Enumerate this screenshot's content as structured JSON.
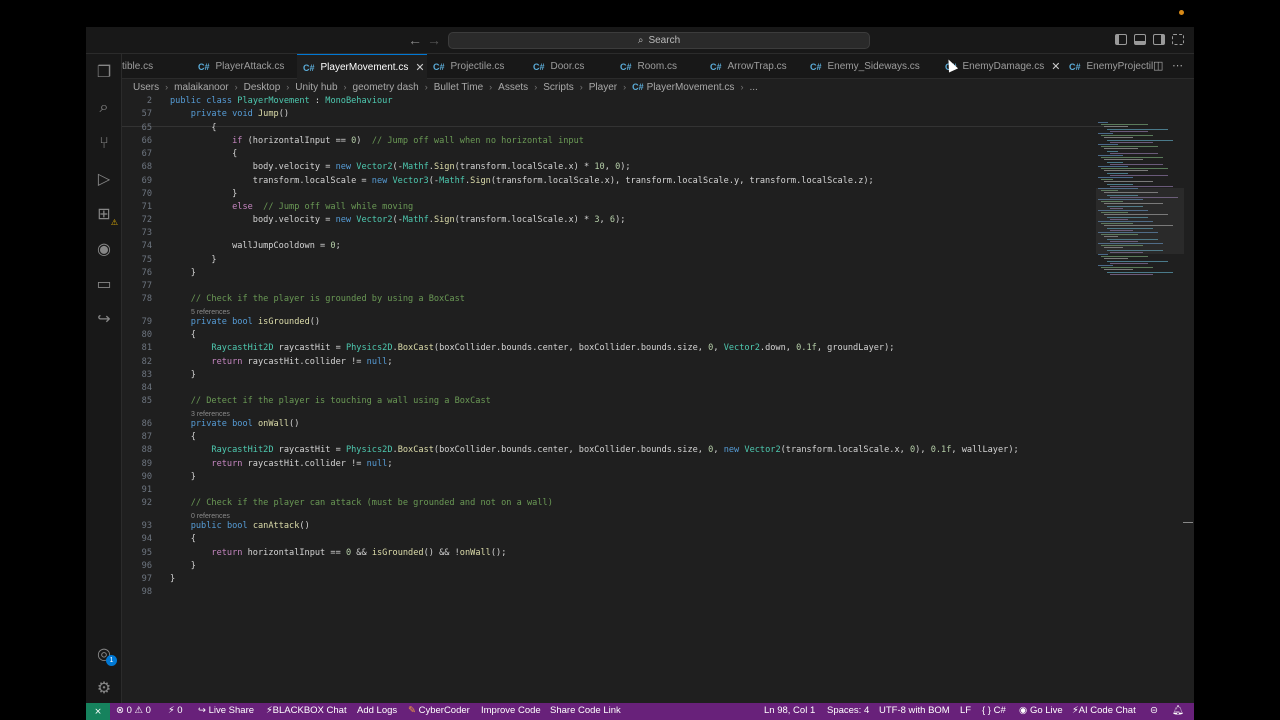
{
  "titlebar": {
    "search_placeholder": "Search",
    "search_icon": "search-icon"
  },
  "tabs": [
    {
      "label": "tible.cs",
      "active": false
    },
    {
      "label": "PlayerAttack.cs",
      "active": false
    },
    {
      "label": "PlayerMovement.cs",
      "active": true
    },
    {
      "label": "Projectile.cs",
      "active": false
    },
    {
      "label": "Door.cs",
      "active": false
    },
    {
      "label": "Room.cs",
      "active": false
    },
    {
      "label": "ArrowTrap.cs",
      "active": false
    },
    {
      "label": "Enemy_Sideways.cs",
      "active": false
    },
    {
      "label": "EnemyDamage.cs",
      "active": false
    },
    {
      "label": "EnemyProjectile",
      "active": false
    }
  ],
  "tab_icon_label": "C#",
  "breadcrumb": [
    "Users",
    "malaikanoor",
    "Desktop",
    "Unity hub",
    "geometry dash",
    "Bullet Time",
    "Assets",
    "Scripts",
    "Player",
    "PlayerMovement.cs",
    "..."
  ],
  "activity_badges": {
    "accounts": "1"
  },
  "editor": {
    "sticky": [
      {
        "ln": "2",
        "text": "public class PlayerMovement : MonoBehaviour"
      },
      {
        "ln": "57",
        "text": "    private void Jump()"
      }
    ],
    "lines": [
      {
        "ln": "65",
        "text": "        {"
      },
      {
        "ln": "66",
        "text": "            if (horizontalInput == 0)  // Jump off wall when no horizontal input"
      },
      {
        "ln": "67",
        "text": "            {"
      },
      {
        "ln": "68",
        "text": "                body.velocity = new Vector2(-Mathf.Sign(transform.localScale.x) * 10, 0);"
      },
      {
        "ln": "69",
        "text": "                transform.localScale = new Vector3(-Mathf.Sign(transform.localScale.x), transform.localScale.y, transform.localScale.z);"
      },
      {
        "ln": "70",
        "text": "            }"
      },
      {
        "ln": "71",
        "text": "            else  // Jump off wall while moving"
      },
      {
        "ln": "72",
        "text": "                body.velocity = new Vector2(-Mathf.Sign(transform.localScale.x) * 3, 6);"
      },
      {
        "ln": "73",
        "text": ""
      },
      {
        "ln": "74",
        "text": "            wallJumpCooldown = 0;"
      },
      {
        "ln": "75",
        "text": "        }"
      },
      {
        "ln": "76",
        "text": "    }"
      },
      {
        "ln": "77",
        "text": ""
      },
      {
        "ln": "78",
        "text": "    // Check if the player is grounded by using a BoxCast"
      },
      {
        "refs": "5 references"
      },
      {
        "ln": "79",
        "text": "    private bool isGrounded()"
      },
      {
        "ln": "80",
        "text": "    {"
      },
      {
        "ln": "81",
        "text": "        RaycastHit2D raycastHit = Physics2D.BoxCast(boxCollider.bounds.center, boxCollider.bounds.size, 0, Vector2.down, 0.1f, groundLayer);"
      },
      {
        "ln": "82",
        "text": "        return raycastHit.collider != null;"
      },
      {
        "ln": "83",
        "text": "    }"
      },
      {
        "ln": "84",
        "text": ""
      },
      {
        "ln": "85",
        "text": "    // Detect if the player is touching a wall using a BoxCast"
      },
      {
        "refs": "3 references"
      },
      {
        "ln": "86",
        "text": "    private bool onWall()"
      },
      {
        "ln": "87",
        "text": "    {"
      },
      {
        "ln": "88",
        "text": "        RaycastHit2D raycastHit = Physics2D.BoxCast(boxCollider.bounds.center, boxCollider.bounds.size, 0, new Vector2(transform.localScale.x, 0), 0.1f, wallLayer);"
      },
      {
        "ln": "89",
        "text": "        return raycastHit.collider != null;"
      },
      {
        "ln": "90",
        "text": "    }"
      },
      {
        "ln": "91",
        "text": ""
      },
      {
        "ln": "92",
        "text": "    // Check if the player can attack (must be grounded and not on a wall)"
      },
      {
        "refs": "0 references"
      },
      {
        "ln": "93",
        "text": "    public bool canAttack()"
      },
      {
        "ln": "94",
        "text": "    {"
      },
      {
        "ln": "95",
        "text": "        return horizontalInput == 0 && isGrounded() && !onWall();"
      },
      {
        "ln": "96",
        "text": "    }"
      },
      {
        "ln": "97",
        "text": "}"
      },
      {
        "ln": "98",
        "text": ""
      }
    ]
  },
  "statusbar": {
    "remote_icon": "remote-icon",
    "problems": "⊗ 0  ⚠ 0",
    "ports": "⚡ 0",
    "live_share": "Live Share",
    "blackbox": "BLACKBOX Chat",
    "add_logs": "Add Logs",
    "cybercoder": "CyberCoder",
    "improve_code": "Improve Code",
    "share_code_link": "Share Code Link",
    "position": "Ln 98, Col 1",
    "spaces": "Spaces: 4",
    "encoding": "UTF-8 with BOM",
    "eol": "LF",
    "language": "{ }  C#",
    "go_live": "Go Live",
    "ai_chat": "AI Code Chat"
  }
}
